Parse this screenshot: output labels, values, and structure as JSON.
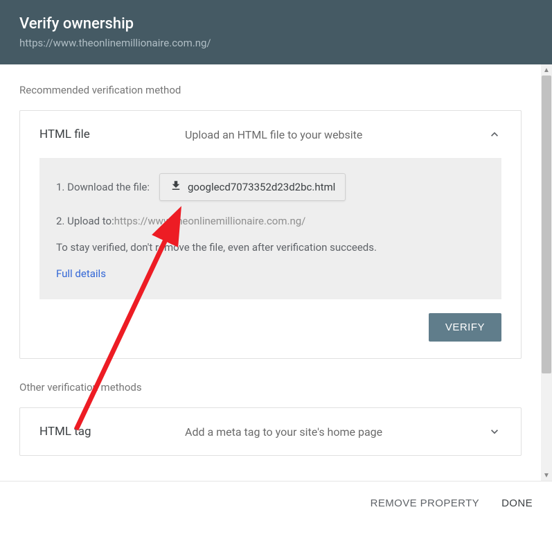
{
  "header": {
    "title": "Verify ownership",
    "url": "https://www.theonlinemillionaire.com.ng/"
  },
  "recommended": {
    "label": "Recommended verification method",
    "method": {
      "title": "HTML file",
      "description": "Upload an HTML file to your website",
      "step1_label": "1. Download the file:",
      "download_filename": "googlecd7073352d23d2bc.html",
      "step2_label": "2. Upload to: ",
      "upload_url": "https://www.theonlinemillionaire.com.ng/",
      "note": "To stay verified, don't remove the file, even after verification succeeds.",
      "details_link": "Full details",
      "verify_button": "VERIFY"
    }
  },
  "other": {
    "label": "Other verification methods",
    "methods": [
      {
        "title": "HTML tag",
        "description": "Add a meta tag to your site's home page"
      }
    ]
  },
  "footer": {
    "remove": "REMOVE PROPERTY",
    "done": "DONE"
  }
}
